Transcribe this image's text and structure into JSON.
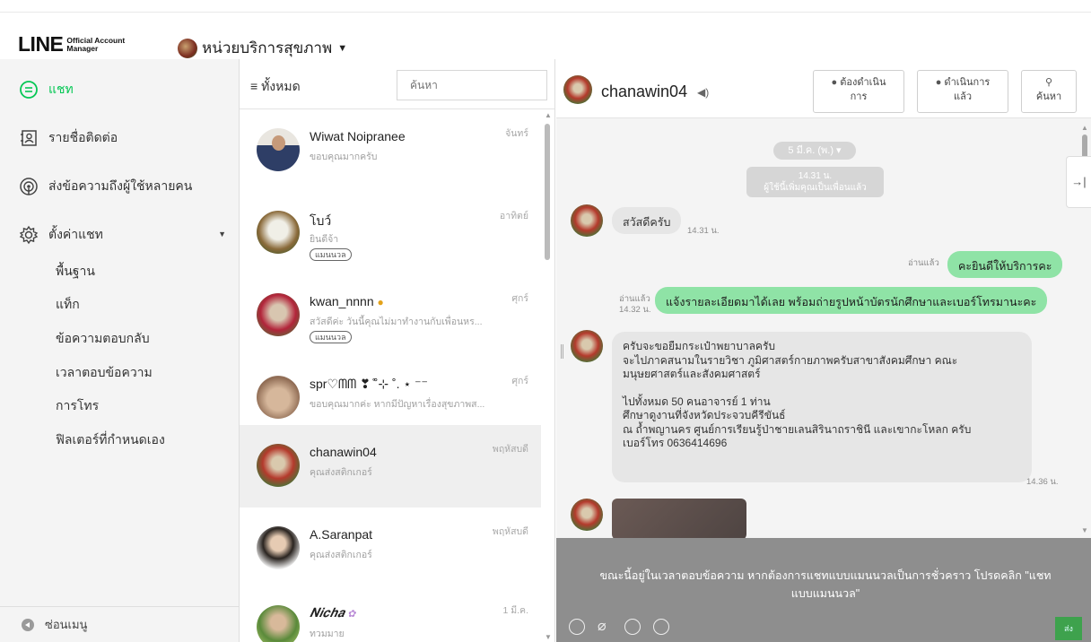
{
  "header": {
    "logo_main": "LINE",
    "logo_sub_1": "Official Account",
    "logo_sub_2": "Manager",
    "account_name": "หน่วยบริการสุขภาพ"
  },
  "sidebar": {
    "items": [
      {
        "label": "แชท",
        "icon": "chat-bubble-icon",
        "active": true
      },
      {
        "label": "รายชื่อติดต่อ",
        "icon": "contacts-icon"
      },
      {
        "label": "ส่งข้อความถึงผู้ใช้หลายคน",
        "icon": "broadcast-icon"
      },
      {
        "label": "ตั้งค่าแชท",
        "icon": "gear-icon"
      }
    ],
    "sub_items": [
      "พื้นฐาน",
      "แท็ก",
      "ข้อความตอบกลับ",
      "เวลาตอบข้อความ",
      "การโทร",
      "ฟิลเตอร์ที่กำหนดเอง"
    ],
    "footer_label": "ซ่อนเมนู",
    "accent": "#06c755"
  },
  "chat_list": {
    "filter_label": "ทั้งหมด",
    "search_placeholder": "ค้นหา",
    "chats": [
      {
        "name": "Wiwat Noipranee",
        "preview": "ขอบคุณมากครับ",
        "date": "จันทร์"
      },
      {
        "name": "โบว์",
        "preview": "ยินดีจ้า",
        "date": "อาทิตย์",
        "tag": "แมนนวล"
      },
      {
        "name": "kwan_nnnn",
        "preview": "สวัสดีค่ะ วันนี้คุณไม่มาทำงานกับเพื่อนหร...",
        "date": "ศุกร์",
        "tag": "แมนนวล"
      },
      {
        "name": "spr♡ᗰᗰ ❣︎ ̊˚⊹ ˚. ⋆ ⁻⁻",
        "preview": "ขอบคุณมากค่ะ หากมีปัญหาเรื่องสุขภาพส...",
        "date": "ศุกร์"
      },
      {
        "name": "chanawin04",
        "preview": "คุณส่งสติกเกอร์",
        "date": "พฤหัสบดี",
        "selected": true
      },
      {
        "name": "A.Saranpat",
        "preview": "คุณส่งสติกเกอร์",
        "date": "พฤหัสบดี"
      },
      {
        "name": "𝑵𝒊𝒄𝒉𝒂",
        "preview": "ทวมมาย",
        "date": "1 มี.ค."
      }
    ]
  },
  "chat": {
    "contact_name": "chanawin04",
    "buttons": {
      "todo_line1": "ต้องดำเนิน",
      "todo_line2": "การ",
      "done_line1": "ดำเนินการ",
      "done_line2": "แล้ว",
      "search": "ค้นหา"
    },
    "date_pill": "5 มี.ค. (พ.) ▾",
    "system_time": "14.31 น.",
    "system_text": "ผู้ใช้นี้เพิ่มคุณเป็นเพื่อนแล้ว",
    "messages": {
      "in1_text": "สวัสดีครับ",
      "in1_time": "14.31 น.",
      "out1_text": "คะยินดีให้บริการคะ",
      "out1_read": "อ่านแล้ว",
      "out2_text": "แจ้งรายละเอียดมาได้เลย พร้อมถ่ายรูปหน้าบัตรนักศึกษาและเบอร์โทรมานะคะ",
      "out2_read": "อ่านแล้ว",
      "out2_time": "14.32 น.",
      "in2_lines": [
        "ครับจะขอยืมกระเป๋าพยาบาลครับ",
        "จะไปภาคสนามในรายวิชา ภูมิศาสตร์กายภาพครับสาขาสังคมศึกษา คณะ",
        "มนุษยศาสตร์และสังคมศาสตร์",
        "",
        "ไปทั้งหมด 50 คนอาจารย์ 1 ท่าน",
        "ศึกษาดูงานที่จังหวัดประจวบคีรีขันธ์",
        "ณ ถ้ำพญานคร ศูนย์การเรียนรู้ป่าชายเลนสิรินาถราชินี และเขากะโหลก ครับ",
        "เบอร์โทร 0636414696"
      ],
      "in2_time": "14.36 น."
    },
    "composer_notice_1": "ขณะนี้อยู่ในเวลาตอบข้อความ หากต้องการแชทแบบแมนนวลเป็นการชั่วคราว โปรดคลิก \"แชท",
    "composer_notice_2": "แบบแมนนวล\"",
    "send_label": "ส่ง",
    "colors": {
      "bubble_out": "#8fe3a6",
      "bubble_in": "#e6e6e6",
      "composer_bg": "#8e8e8e"
    }
  }
}
